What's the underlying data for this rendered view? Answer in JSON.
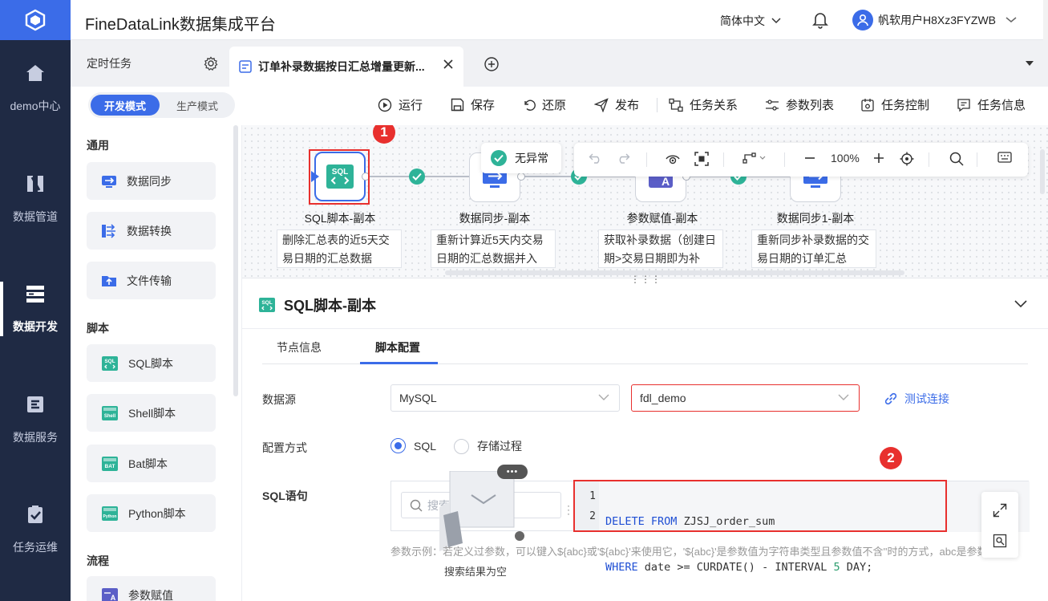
{
  "app": {
    "title": "FineDataLink数据集成平台",
    "language": "简体中文",
    "username": "帆软用户H8Xz3FYZWB"
  },
  "leftnav": [
    {
      "label": "demo中心",
      "icon": "home-icon",
      "active": false
    },
    {
      "label": "数据管道",
      "icon": "pipeline-icon",
      "active": false
    },
    {
      "label": "数据开发",
      "icon": "dev-icon",
      "active": true
    },
    {
      "label": "数据服务",
      "icon": "service-icon",
      "active": false
    },
    {
      "label": "任务运维",
      "icon": "ops-icon",
      "active": false
    }
  ],
  "tabs": {
    "scheduled": "定时任务",
    "active_tab": "订单补录数据按日汇总增量更新..."
  },
  "modes": {
    "dev": "开发模式",
    "prod": "生产模式"
  },
  "toolbar": {
    "run": "运行",
    "save": "保存",
    "restore": "还原",
    "publish": "发布",
    "relations": "任务关系",
    "params": "参数列表",
    "control": "任务控制",
    "info": "任务信息"
  },
  "palette": {
    "groups": {
      "general": "通用",
      "script": "脚本",
      "flow": "流程"
    },
    "items": [
      "数据同步",
      "数据转换",
      "文件传输",
      "SQL脚本",
      "Shell脚本",
      "Bat脚本",
      "Python脚本",
      "参数赋值"
    ]
  },
  "canvas": {
    "status": "无异常",
    "zoom": "100%",
    "nodes": [
      {
        "label": "SQL脚本-副本",
        "desc": "删除汇总表的近5天交易日期的汇总数据"
      },
      {
        "label": "数据同步-副本",
        "desc": "重新计算近5天内交易日期的汇总数据并入"
      },
      {
        "label": "参数赋值-副本",
        "desc": "获取补录数据（创建日期>交易日期即为补"
      },
      {
        "label": "数据同步1-副本",
        "desc": "重新同步补录数据的交易日期的订单汇总"
      }
    ],
    "badge1": "1"
  },
  "panel": {
    "title": "SQL脚本-副本",
    "tab_node_info": "节点信息",
    "tab_script_config": "脚本配置",
    "datasource_label": "数据源",
    "db_type": "MySQL",
    "db_name": "fdl_demo",
    "test_conn": "测试连接",
    "config_label": "配置方式",
    "opt_sql": "SQL",
    "opt_proc": "存储过程",
    "sql_label": "SQL语句",
    "search_placeholder": "搜索库/表、视图",
    "code_line1_kw1": "DELETE",
    "code_line1_kw2": "FROM",
    "code_line1_rest": " ZJSJ_order_sum",
    "code_line2_kw": "WHERE",
    "code_line2_a": " date >= CURDATE() - INTERVAL ",
    "code_line2_num": "5",
    "code_line2_b": " DAY;",
    "hint": "参数示例：若定义过参数，可以键入${abc}或'${abc}'来使用它，'${abc}'是参数值为字符串类型且参数值不含''时的方式，abc是参数名。",
    "empty_text": "搜索结果为空",
    "badge2": "2"
  }
}
